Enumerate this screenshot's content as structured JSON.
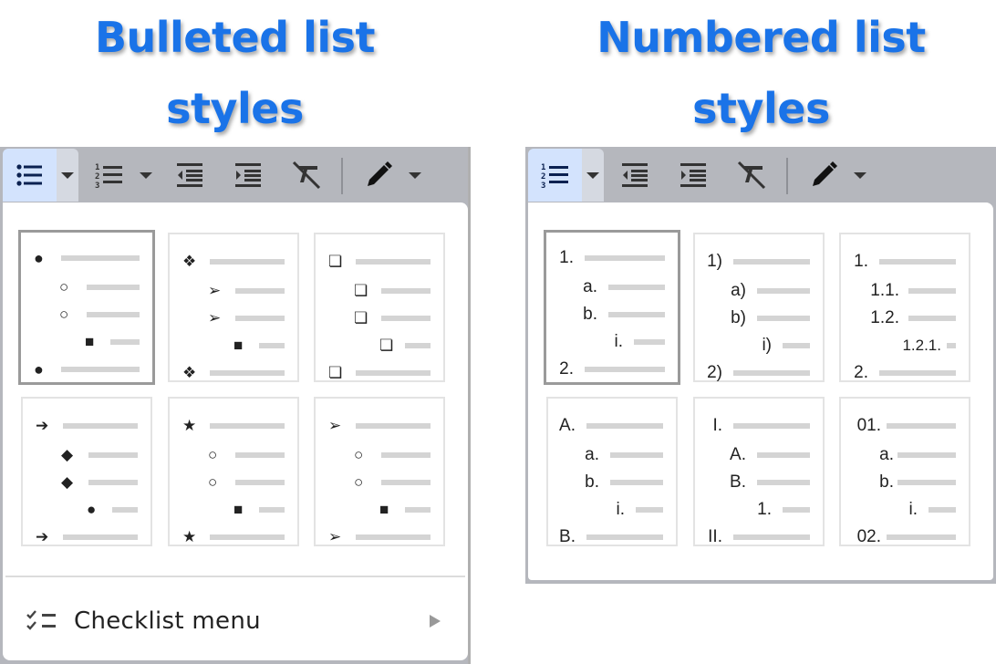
{
  "headings": {
    "bulleted": [
      "Bulleted list",
      "styles"
    ],
    "numbered": [
      "Numbered list",
      "styles"
    ]
  },
  "colors": {
    "heading": "#1a73e8",
    "toolbar_bg": "#b5b7bd",
    "active_button": "#d3e3fd",
    "selected_border": "#9a9a9a"
  },
  "bulleted_panel": {
    "toolbar": [
      {
        "name": "bulleted-list-button",
        "icon": "bulleted-list-icon",
        "active": true
      },
      {
        "name": "bulleted-list-dropdown",
        "icon": "dropdown-arrow-icon",
        "active": true
      },
      {
        "name": "numbered-list-button",
        "icon": "numbered-list-icon"
      },
      {
        "name": "numbered-list-dropdown",
        "icon": "dropdown-arrow-icon"
      },
      {
        "name": "decrease-indent-button",
        "icon": "decrease-indent-icon"
      },
      {
        "name": "increase-indent-button",
        "icon": "increase-indent-icon"
      },
      {
        "name": "clear-formatting-button",
        "icon": "clear-formatting-icon"
      },
      {
        "name": "edit-mode-button",
        "icon": "pencil-icon"
      },
      {
        "name": "edit-mode-dropdown",
        "icon": "dropdown-arrow-icon"
      }
    ],
    "presets": [
      {
        "selected": true,
        "glyphs": [
          "●",
          "○",
          "○",
          "■",
          "●"
        ]
      },
      {
        "selected": false,
        "glyphs": [
          "❖",
          "➢",
          "➢",
          "■",
          "❖"
        ]
      },
      {
        "selected": false,
        "glyphs": [
          "❏",
          "❏",
          "❏",
          "❏",
          "❏"
        ]
      },
      {
        "selected": false,
        "glyphs": [
          "➔",
          "◆",
          "◆",
          "●",
          "➔"
        ]
      },
      {
        "selected": false,
        "glyphs": [
          "★",
          "○",
          "○",
          "■",
          "★"
        ]
      },
      {
        "selected": false,
        "glyphs": [
          "➢",
          "○",
          "○",
          "■",
          "➢"
        ]
      }
    ],
    "checklist_menu": {
      "label": "Checklist menu",
      "icon": "checklist-icon",
      "submenu_icon": "submenu-arrow-icon"
    }
  },
  "numbered_panel": {
    "toolbar": [
      {
        "name": "numbered-list-button",
        "icon": "numbered-list-icon",
        "active": true
      },
      {
        "name": "numbered-list-dropdown",
        "icon": "dropdown-arrow-icon",
        "active": true
      },
      {
        "name": "decrease-indent-button",
        "icon": "decrease-indent-icon"
      },
      {
        "name": "increase-indent-button",
        "icon": "increase-indent-icon"
      },
      {
        "name": "clear-formatting-button",
        "icon": "clear-formatting-icon"
      },
      {
        "name": "edit-mode-button",
        "icon": "pencil-icon"
      },
      {
        "name": "edit-mode-dropdown",
        "icon": "dropdown-arrow-icon"
      }
    ],
    "presets": [
      {
        "selected": true,
        "labels": [
          "1.",
          "a.",
          "b.",
          "i.",
          "2."
        ]
      },
      {
        "selected": false,
        "labels": [
          "1)",
          "a)",
          "b)",
          "i)",
          "2)"
        ]
      },
      {
        "selected": false,
        "labels": [
          "1.",
          "1.1.",
          "1.2.",
          "1.2.1.",
          "2."
        ]
      },
      {
        "selected": false,
        "labels": [
          "A.",
          "a.",
          "b.",
          "i.",
          "B."
        ]
      },
      {
        "selected": false,
        "labels": [
          "I.",
          "A.",
          "B.",
          "1.",
          "II."
        ]
      },
      {
        "selected": false,
        "labels": [
          "01.",
          "a.",
          "b.",
          "i.",
          "02."
        ]
      }
    ]
  }
}
